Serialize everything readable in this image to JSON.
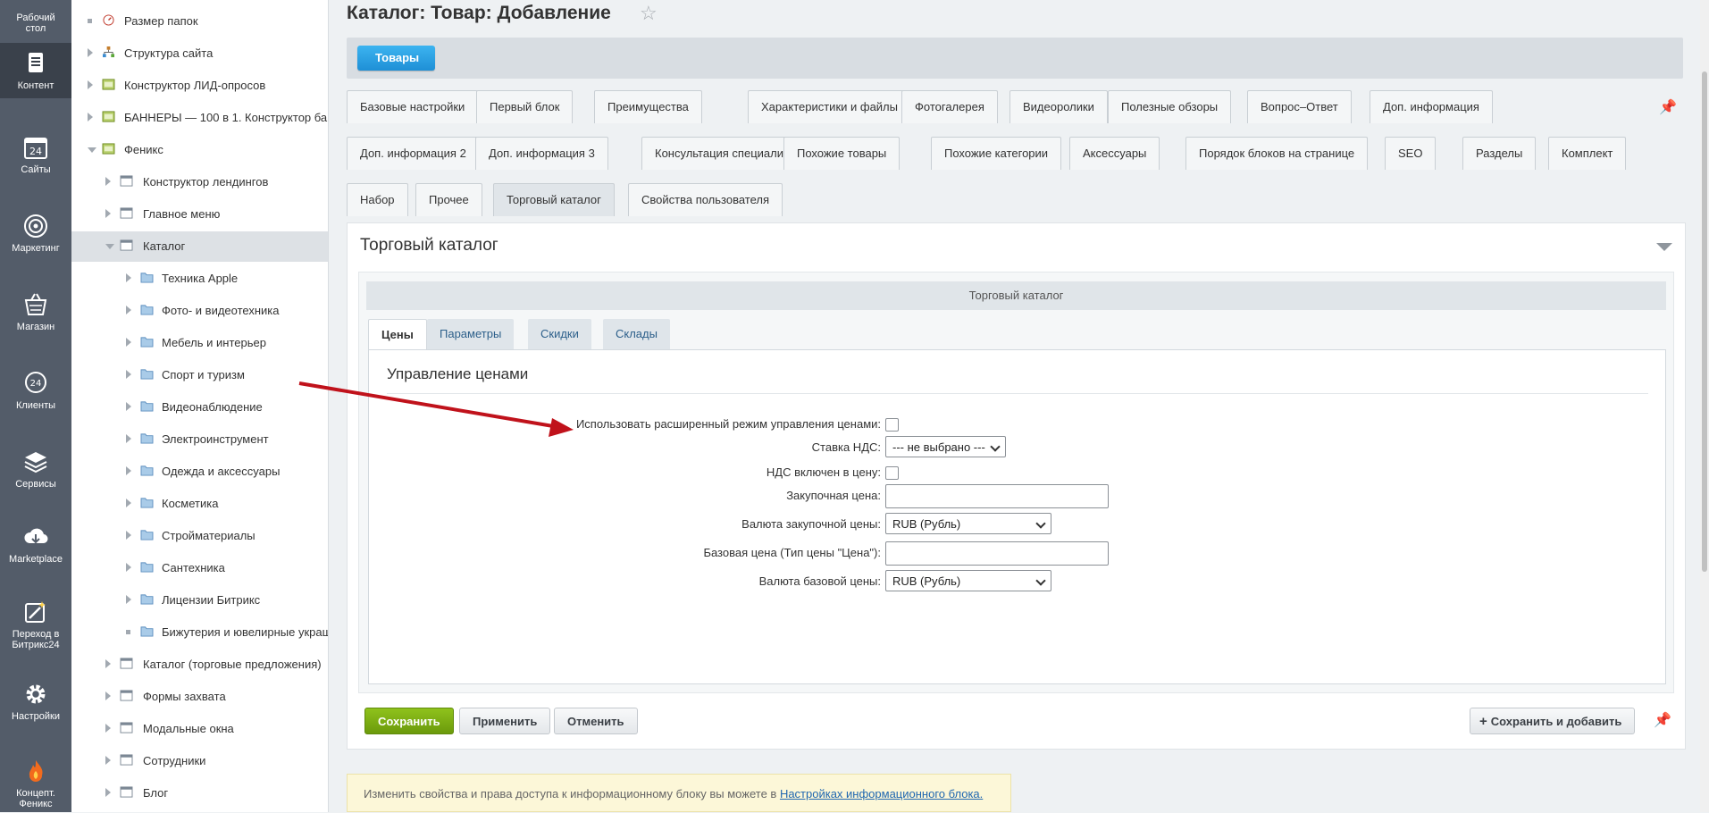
{
  "rail": [
    {
      "label": "Рабочий стол",
      "icon": "desktop-icon"
    },
    {
      "label": "Контент",
      "icon": "content-icon",
      "active": true
    },
    {
      "label": "Сайты",
      "icon": "calendar-24-icon"
    },
    {
      "label": "Маркетинг",
      "icon": "target-icon"
    },
    {
      "label": "Магазин",
      "icon": "cart-icon"
    },
    {
      "label": "Клиенты",
      "icon": "clients-24-icon"
    },
    {
      "label": "Сервисы",
      "icon": "layers-icon"
    },
    {
      "label": "Marketplace",
      "icon": "cloud-download-icon"
    },
    {
      "label": "Переход в Битрикс24",
      "icon": "magic-wand-icon"
    },
    {
      "label": "Настройки",
      "icon": "gear-icon"
    },
    {
      "label": "Концепт. Феникс",
      "icon": "flame-icon"
    }
  ],
  "tree": [
    {
      "label": "Размер папок",
      "level": 0,
      "marker": "dot",
      "icon": "gauge-icon"
    },
    {
      "label": "Структура сайта",
      "level": 0,
      "marker": "arrow",
      "icon": "sitemap-icon"
    },
    {
      "label": "Конструктор ЛИД-опросов",
      "level": 0,
      "marker": "arrow",
      "icon": "site-icon"
    },
    {
      "label": "БАННЕРЫ — 100 в 1. Конструктор ба",
      "level": 0,
      "marker": "arrow",
      "icon": "site-icon"
    },
    {
      "label": "Феникс",
      "level": 0,
      "marker": "down",
      "icon": "site-icon"
    },
    {
      "label": "Конструктор лендингов",
      "level": 1,
      "marker": "arrow",
      "icon": "iblock-icon"
    },
    {
      "label": "Главное меню",
      "level": 1,
      "marker": "arrow",
      "icon": "iblock-icon"
    },
    {
      "label": "Каталог",
      "level": 1,
      "marker": "down",
      "icon": "iblock-icon",
      "selected": true
    },
    {
      "label": "Техника Apple",
      "level": 2,
      "marker": "arrow",
      "icon": "folder-icon"
    },
    {
      "label": "Фото- и видеотехника",
      "level": 2,
      "marker": "arrow",
      "icon": "folder-icon"
    },
    {
      "label": "Мебель и интерьер",
      "level": 2,
      "marker": "arrow",
      "icon": "folder-icon"
    },
    {
      "label": "Спорт и туризм",
      "level": 2,
      "marker": "arrow",
      "icon": "folder-icon"
    },
    {
      "label": "Видеонаблюдение",
      "level": 2,
      "marker": "arrow",
      "icon": "folder-icon"
    },
    {
      "label": "Электроинструмент",
      "level": 2,
      "marker": "arrow",
      "icon": "folder-icon"
    },
    {
      "label": "Одежда и аксессуары",
      "level": 2,
      "marker": "arrow",
      "icon": "folder-icon"
    },
    {
      "label": "Косметика",
      "level": 2,
      "marker": "arrow",
      "icon": "folder-icon"
    },
    {
      "label": "Стройматериалы",
      "level": 2,
      "marker": "arrow",
      "icon": "folder-icon"
    },
    {
      "label": "Сантехника",
      "level": 2,
      "marker": "arrow",
      "icon": "folder-icon"
    },
    {
      "label": "Лицензии Битрикс",
      "level": 2,
      "marker": "arrow",
      "icon": "folder-icon"
    },
    {
      "label": "Бижутерия и ювелирные украш",
      "level": 2,
      "marker": "dot",
      "icon": "folder-icon"
    },
    {
      "label": "Каталог (торговые предложения)",
      "level": 1,
      "marker": "arrow",
      "icon": "iblock-icon"
    },
    {
      "label": "Формы захвата",
      "level": 1,
      "marker": "arrow",
      "icon": "iblock-icon"
    },
    {
      "label": "Модальные окна",
      "level": 1,
      "marker": "arrow",
      "icon": "iblock-icon"
    },
    {
      "label": "Сотрудники",
      "level": 1,
      "marker": "arrow",
      "icon": "iblock-icon"
    },
    {
      "label": "Блог",
      "level": 1,
      "marker": "arrow",
      "icon": "iblock-icon"
    }
  ],
  "page": {
    "title": "Каталог: Товар: Добавление",
    "crumb": "Товары"
  },
  "tabs": {
    "row1": [
      "Базовые настройки",
      "Первый блок",
      "Преимущества",
      "Характеристики и файлы",
      "Фотогалерея",
      "Видеоролики",
      "Полезные обзоры",
      "Вопрос–Ответ",
      "Доп. информация"
    ],
    "row2": [
      "Доп. информация 2",
      "Доп. информация 3",
      "Консультация специалиста",
      "Похожие товары",
      "Похожие категории",
      "Аксессуары",
      "Порядок блоков на странице",
      "SEO",
      "Разделы",
      "Комплект"
    ],
    "row3": [
      "Набор",
      "Прочее",
      "Торговый каталог",
      "Свойства пользователя"
    ],
    "active": "Торговый каталог"
  },
  "panel": {
    "title": "Торговый каталог",
    "inner_title": "Торговый каталог",
    "subtabs": [
      "Цены",
      "Параметры",
      "Скидки",
      "Склады"
    ],
    "active_subtab": "Цены",
    "section_title": "Управление ценами",
    "fields": {
      "advanced_mode": {
        "label": "Использовать расширенный режим управления ценами:",
        "checked": false
      },
      "vat_rate": {
        "label": "Ставка НДС:",
        "value": "--- не выбрано ---"
      },
      "vat_included": {
        "label": "НДС включен в цену:",
        "checked": false
      },
      "purchase_price": {
        "label": "Закупочная цена:",
        "value": ""
      },
      "purchase_currency": {
        "label": "Валюта закупочной цены:",
        "value": "RUB (Рубль)"
      },
      "base_price": {
        "label": "Базовая цена (Тип цены \"Цена\"):",
        "value": ""
      },
      "base_currency": {
        "label": "Валюта базовой цены:",
        "value": "RUB (Рубль)"
      }
    }
  },
  "buttons": {
    "save": "Сохранить",
    "apply": "Применить",
    "cancel": "Отменить",
    "save_add": "Сохранить и добавить"
  },
  "notice": {
    "text": "Изменить свойства и права доступа к информационному блоку вы можете в ",
    "link": "Настройках информационного блока."
  },
  "colors": {
    "rail": "#535c69",
    "accent_blue": "#1e8fd6",
    "save_green": "#7aab13",
    "arrow_red": "#c0121b"
  }
}
